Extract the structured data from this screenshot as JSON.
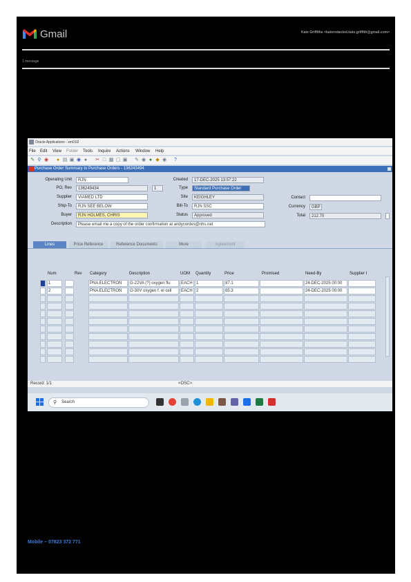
{
  "email": {
    "brand": "Gmail",
    "sender_line": "Kate Griffiths <kateredacted.kate.griffith@gmail.com>",
    "message_count": "1 message",
    "mobile": "Mobile – 07823 372 771"
  },
  "window": {
    "title": "Oracle Applications - sm01l2",
    "menu": [
      "File",
      "Edit",
      "View",
      "Folder",
      "Tools",
      "Inquire",
      "Actions",
      "Window",
      "Help"
    ]
  },
  "form": {
    "title": "Purchase Order Summary to Purchase Orders - 136243494",
    "labels": {
      "operating_unit": "Operating Unit",
      "po_rev": "PO, Rev",
      "supplier": "Supplier",
      "ship_to": "Ship-To",
      "buyer": "Buyer",
      "description": "Description",
      "created": "Created",
      "type": "Type",
      "site": "Site",
      "bill_to": "Bill-To",
      "status": "Status",
      "contact": "Contact",
      "currency": "Currency",
      "total": "Total"
    },
    "values": {
      "operating_unit": "RJN",
      "po_number": "136249434",
      "revision": "1",
      "supplier": "VIAMED LTD",
      "ship_to": "RJN SEE BELOW",
      "buyer": "RJN HOLMES, CHRIS",
      "description": "Please email me a copy of the order confirmation at andycordes@nhs.net",
      "created": "17-DEC-2025 13:57:22",
      "type": "Standard Purchase Order",
      "site": "KEIGHLEY",
      "bill_to": "RJN SSC",
      "status": "Approved",
      "contact": "",
      "currency": "GBP",
      "total": "212.70"
    }
  },
  "tabs": [
    "Lines",
    "Price Reference",
    "Reference Documents",
    "More",
    "Agreement"
  ],
  "lines": {
    "columns": [
      "Num",
      "Rev",
      "Category",
      "Description",
      "UOM",
      "Quantity",
      "Price",
      "Promised",
      "Need-By",
      "Supplier I"
    ],
    "rows": [
      [
        "1",
        "",
        "PNA ELECTRON",
        "G-22VA (?) oxygen flu",
        "EACH",
        "1",
        "87.1",
        "",
        "24-DEC-2025 00:00",
        ""
      ],
      [
        "2",
        "",
        "PNA ELECTRON",
        "G-30V oxygen f. el cell",
        "EACH",
        "2",
        "65.3",
        "",
        "24-DEC-2025 00:00",
        ""
      ]
    ]
  },
  "statusbar": {
    "record": "Record: 1/1",
    "osc": "<OSC>"
  },
  "taskbar": {
    "search_placeholder": "Search"
  },
  "colors": {
    "accent": "#3c6fb8",
    "highlight": "#fff5b3"
  }
}
